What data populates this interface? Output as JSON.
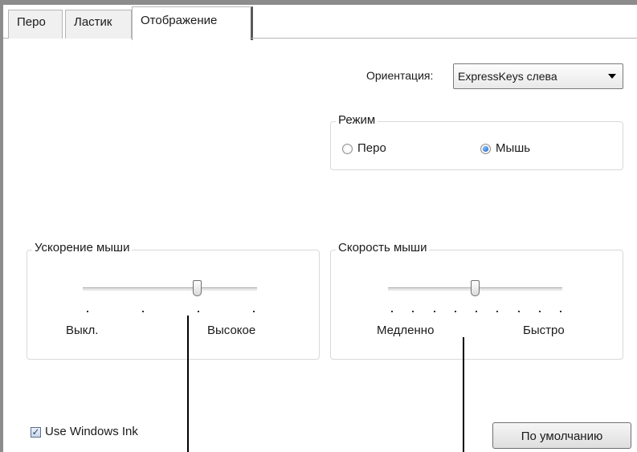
{
  "tabs": [
    {
      "label": "Перо",
      "active": false
    },
    {
      "label": "Ластик",
      "active": false
    },
    {
      "label": "Отображение",
      "active": true
    }
  ],
  "orientation": {
    "label": "Ориентация:",
    "selected": "ExpressKeys слева"
  },
  "mode": {
    "title": "Режим",
    "options": [
      {
        "label": "Перо",
        "checked": false
      },
      {
        "label": "Мышь",
        "checked": true
      }
    ]
  },
  "mouse_acceleration": {
    "title": "Ускорение мыши",
    "min_label": "Выкл.",
    "max_label": "Высокое",
    "tick_count": 4,
    "selected_tick": 3
  },
  "mouse_speed": {
    "title": "Скорость мыши",
    "min_label": "Медленно",
    "max_label": "Быстро",
    "tick_count": 9,
    "selected_tick": 5
  },
  "windows_ink": {
    "label": "Use Windows Ink",
    "checked": true
  },
  "default_button": {
    "label": "По умолчанию"
  }
}
